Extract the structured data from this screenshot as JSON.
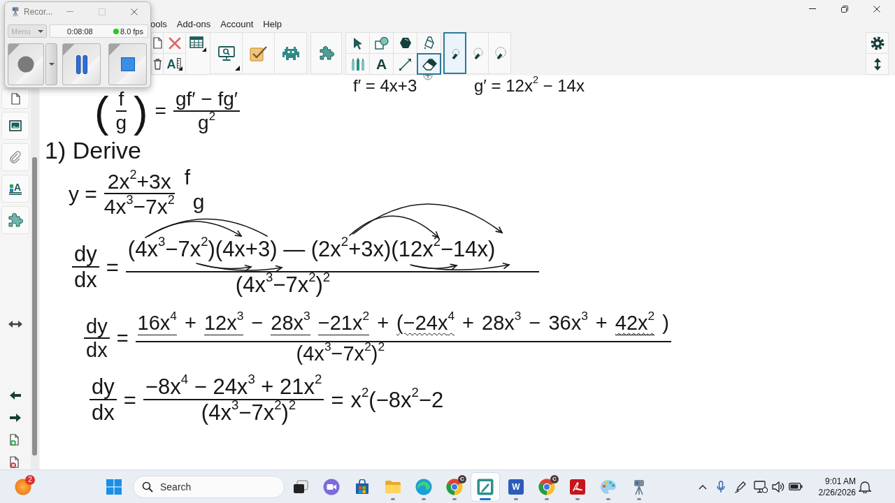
{
  "recorder": {
    "title": "Recor...",
    "menu": {
      "label": "Menu",
      "disabled": true
    },
    "elapsed": "0:08:08",
    "recording": true,
    "fps": "8.0 fps"
  },
  "app": {
    "menu": [
      "ools",
      "Add-ons",
      "Account",
      "Help"
    ],
    "toolbar": {
      "ruler_label": "A",
      "tools": [
        {
          "selected": false
        },
        {
          "selected": false
        },
        {
          "selected": false
        },
        {
          "selected": false
        },
        {
          "selected": false
        },
        {
          "label": "A",
          "selected": false
        },
        {
          "selected": false
        },
        {
          "selected": true
        }
      ],
      "sizes": [
        {
          "selected": true
        },
        {
          "selected": false
        },
        {
          "selected": false
        }
      ]
    },
    "sidebar": {
      "text_label": "A"
    }
  },
  "canvas": {
    "expressions": [
      {
        "parts": [
          {
            "kind": "text",
            "text": "f′ = 4x+3"
          }
        ]
      },
      {
        "parts": [
          {
            "kind": "text",
            "text": "g′ = 12x$^{2}$ − 14x"
          }
        ]
      },
      {
        "parts": [
          {
            "kind": "paren_frac",
            "open": "(",
            "num": "f",
            "den": "g",
            "close": ")"
          },
          {
            "kind": "text",
            "text": "="
          },
          {
            "kind": "frac",
            "num": "gf′ − fg′",
            "den": "g$^{2}$"
          }
        ]
      },
      {
        "parts": [
          {
            "kind": "heading",
            "text": "1) Derive"
          }
        ]
      },
      {
        "parts": [
          {
            "kind": "text",
            "text": "y ="
          },
          {
            "kind": "frac",
            "num": "2x$^{2}$+3x",
            "den": "4x$^{3}$−7x$^{2}$",
            "num_label": "f",
            "den_label": "g"
          }
        ]
      },
      {
        "parts": [
          {
            "kind": "frac",
            "num": "dy",
            "den": "dx"
          },
          {
            "kind": "text",
            "text": "="
          },
          {
            "kind": "frac",
            "num": "(4x$^{3}$−7x$^{2}$)(4x+3) — (2x$^{2}$+3x)(12x$^{2}$−14x)",
            "den": "(4x$^{3}$−7x$^{2}$)$^{2}$"
          }
        ]
      },
      {
        "parts": [
          {
            "kind": "frac",
            "num": "dy",
            "den": "dx"
          },
          {
            "kind": "text",
            "text": "="
          },
          {
            "kind": "frac",
            "num": [
              {
                "text": "16x$^{4}$",
                "underlined": true,
                "wavy": false
              },
              {
                "text": "+",
                "underlined": false,
                "wavy": false
              },
              {
                "text": "12x$^{3}$",
                "underlined": true,
                "wavy": false
              },
              {
                "text": "−",
                "underlined": false,
                "wavy": false
              },
              {
                "text": "28x$^{3}$",
                "underlined": true,
                "wavy": false
              },
              {
                "text": "−21x$^{2}$",
                "underlined": true,
                "wavy": false
              },
              {
                "text": "+",
                "underlined": false,
                "wavy": false
              },
              {
                "text": "(−24x$^{4}$",
                "underlined": false,
                "wavy": true
              },
              {
                "text": "+",
                "underlined": false,
                "wavy": false
              },
              {
                "text": "28x$^{3}$",
                "underlined": false,
                "wavy": false
              },
              {
                "text": "−",
                "underlined": false,
                "wavy": false
              },
              {
                "text": "36x$^{3}$",
                "underlined": false,
                "wavy": false
              },
              {
                "text": "+",
                "underlined": false,
                "wavy": false
              },
              {
                "text": "42x$^{2}$",
                "underlined": true,
                "wavy": true
              },
              {
                "text": ")",
                "underlined": false,
                "wavy": false
              }
            ],
            "den": "(4x$^{3}$−7x$^{2}$)$^{2}$"
          }
        ]
      },
      {
        "parts": [
          {
            "kind": "frac",
            "num": "dy",
            "den": "dx"
          },
          {
            "kind": "text",
            "text": "="
          },
          {
            "kind": "frac",
            "num": "−8x$^{4}$ − 24x$^{3}$ + 21x$^{2}$",
            "den": "(4x$^{3}$−7x$^{2}$)$^{2}$"
          },
          {
            "kind": "text",
            "text": "="
          },
          {
            "kind": "text",
            "text": "x$^{2}$(−8x$^{2}$−2"
          }
        ]
      }
    ]
  },
  "taskbar": {
    "widget": {
      "badge": "2"
    },
    "search": {
      "placeholder": "Search"
    },
    "apps": [
      {
        "running": false,
        "selected": false
      },
      {
        "running": false,
        "selected": false
      },
      {
        "running": false,
        "selected": false
      },
      {
        "running": true,
        "selected": false
      },
      {
        "running": true,
        "selected": false
      },
      {
        "running": true,
        "selected": false,
        "badge": "C"
      },
      {
        "running": true,
        "selected": true
      },
      {
        "running": true,
        "selected": false,
        "letter": "W"
      },
      {
        "running": true,
        "selected": false,
        "badge": "C"
      },
      {
        "running": true,
        "selected": false
      },
      {
        "running": true,
        "selected": false
      },
      {
        "running": true,
        "selected": false
      }
    ],
    "clock": {
      "time": "9:01 AM",
      "date": "2/26/2026"
    }
  }
}
